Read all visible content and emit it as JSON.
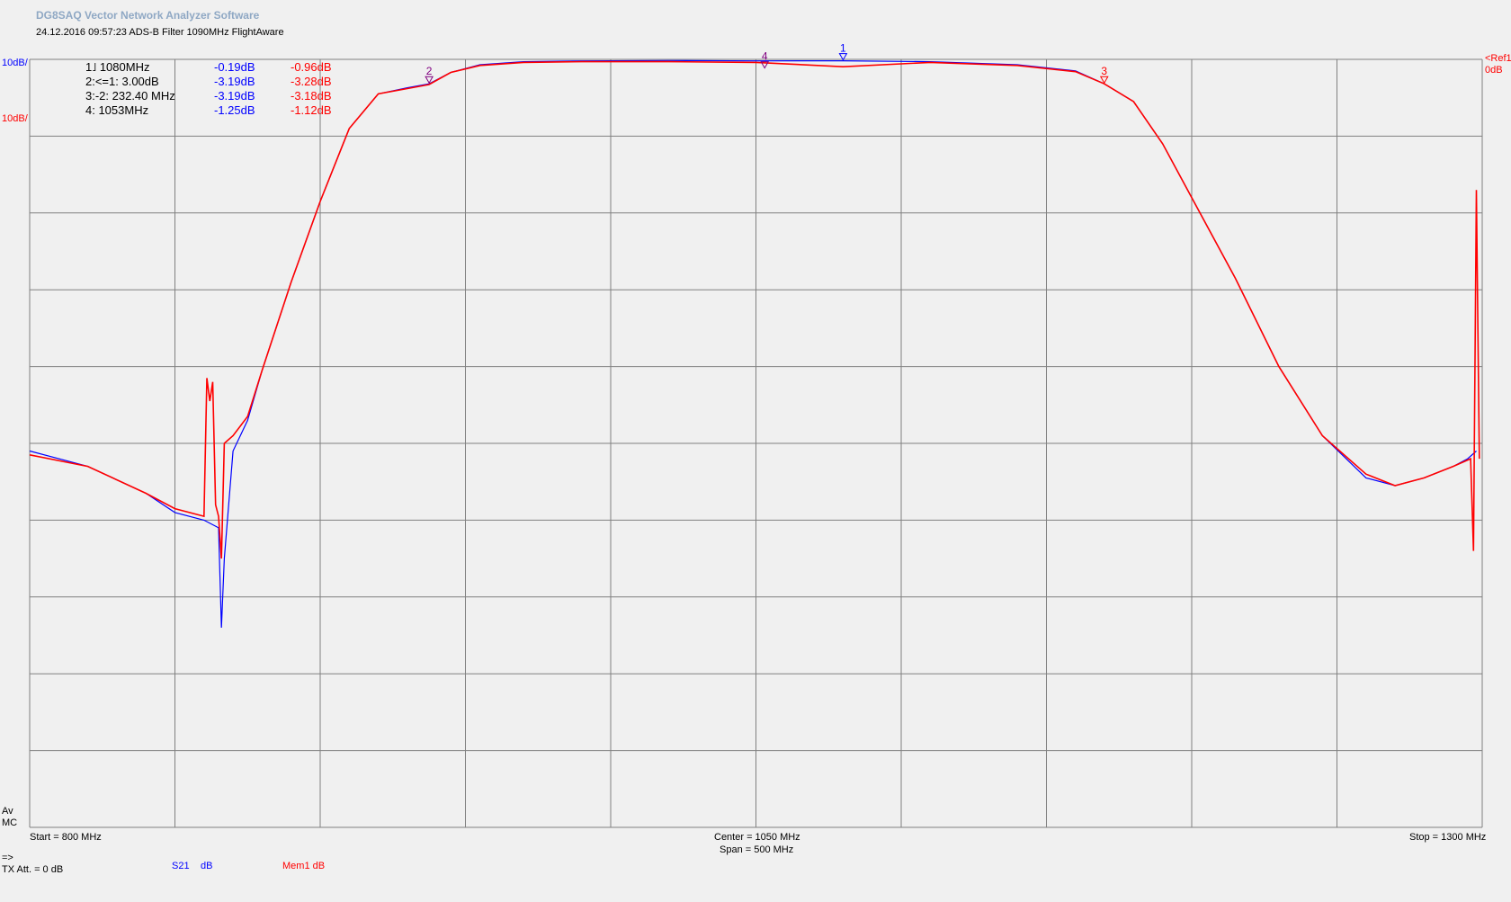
{
  "app_title": "DG8SAQ Vector Network Analyzer Software",
  "subtitle": "24.12.2016   09:57:23    ADS-B Filter 1090MHz FlightAware",
  "ref_left_blue": "10dB/",
  "ref_left_red": "10dB/",
  "ref_right": "<Ref",
  "ref_right_value": "0dB",
  "ref_right_suffix": "1",
  "marker_table": [
    {
      "label": "1˩  1080MHz",
      "s21": "-0.19dB",
      "mem1": "-0.96dB"
    },
    {
      "label": "2:<=1:  3.00dB",
      "s21": "-3.19dB",
      "mem1": "-3.28dB"
    },
    {
      "label": "3:-2:  232.40 MHz",
      "s21": "-3.19dB",
      "mem1": "-3.18dB"
    },
    {
      "label": "4:  1053MHz",
      "s21": "-1.25dB",
      "mem1": "-1.12dB"
    }
  ],
  "footer": {
    "av": "Av",
    "mc": "MC",
    "start": "Start = 800 MHz",
    "center": "Center = 1050 MHz",
    "span": "Span = 500 MHz",
    "stop": "Stop = 1300 MHz",
    "arrow": "=>",
    "tx_att": "TX Att.  = 0 dB",
    "trace1_name": "S21",
    "trace1_unit": "dB",
    "trace2_name": "Mem1 dB"
  },
  "colors": {
    "trace_s21": "#0000ff",
    "trace_mem1": "#ff0000",
    "grid": "#808080",
    "plot_bg": "#f0f0f0"
  },
  "chart_data": {
    "type": "line",
    "title": "",
    "xlabel": "",
    "ylabel": "",
    "xlim": [
      800,
      1300
    ],
    "ylim": [
      -100,
      0
    ],
    "x_unit": "MHz",
    "y_unit": "dB",
    "grid": true,
    "legend": "bottom",
    "markers": [
      {
        "id": "1",
        "x": 1080,
        "y": -0.19
      },
      {
        "id": "2",
        "x": 937.5,
        "y": -3.19
      },
      {
        "id": "3",
        "x": 1169.9,
        "y": -3.19
      },
      {
        "id": "4",
        "x": 1053,
        "y": -1.25
      }
    ],
    "series": [
      {
        "name": "S21",
        "color": "#0000ff",
        "x": [
          800,
          820,
          840,
          850,
          860,
          865,
          866,
          867,
          870,
          875,
          880,
          890,
          900,
          910,
          920,
          930,
          937.5,
          945,
          955,
          970,
          990,
          1020,
          1050,
          1080,
          1110,
          1140,
          1160,
          1169.9,
          1180,
          1190,
          1200,
          1215,
          1230,
          1245,
          1260,
          1270,
          1280,
          1290,
          1295,
          1298
        ],
        "y": [
          -51,
          -53,
          -56.5,
          -59,
          -60,
          -61,
          -74,
          -65,
          -51,
          -47,
          -40.5,
          -29,
          -18.5,
          -9,
          -4.5,
          -3.7,
          -3.19,
          -1.7,
          -0.7,
          -0.3,
          -0.2,
          -0.15,
          -0.2,
          -0.19,
          -0.3,
          -0.7,
          -1.5,
          -3.19,
          -5.5,
          -11,
          -18,
          -28.5,
          -40,
          -49,
          -54.5,
          -55.5,
          -54.5,
          -53,
          -52,
          -51
        ]
      },
      {
        "name": "Mem1",
        "color": "#ff0000",
        "x": [
          800,
          820,
          840,
          850,
          860,
          861,
          862,
          863,
          864,
          865,
          866,
          867,
          870,
          875,
          880,
          890,
          900,
          910,
          920,
          930,
          937.5,
          945,
          955,
          970,
          990,
          1020,
          1050,
          1080,
          1110,
          1140,
          1160,
          1169.9,
          1180,
          1190,
          1200,
          1215,
          1230,
          1245,
          1260,
          1270,
          1280,
          1290,
          1296,
          1297,
          1298,
          1299
        ],
        "y": [
          -51.5,
          -53,
          -56.5,
          -58.5,
          -59.5,
          -41.5,
          -44.5,
          -42,
          -58,
          -59.5,
          -65,
          -50,
          -49,
          -46.5,
          -40.5,
          -29,
          -18.5,
          -9,
          -4.5,
          -3.8,
          -3.28,
          -1.7,
          -0.8,
          -0.4,
          -0.3,
          -0.3,
          -0.4,
          -0.96,
          -0.4,
          -0.8,
          -1.6,
          -3.18,
          -5.5,
          -11,
          -18,
          -28.5,
          -40,
          -49,
          -54,
          -55.5,
          -54.5,
          -53,
          -52,
          -64,
          -17,
          -52
        ]
      }
    ]
  }
}
